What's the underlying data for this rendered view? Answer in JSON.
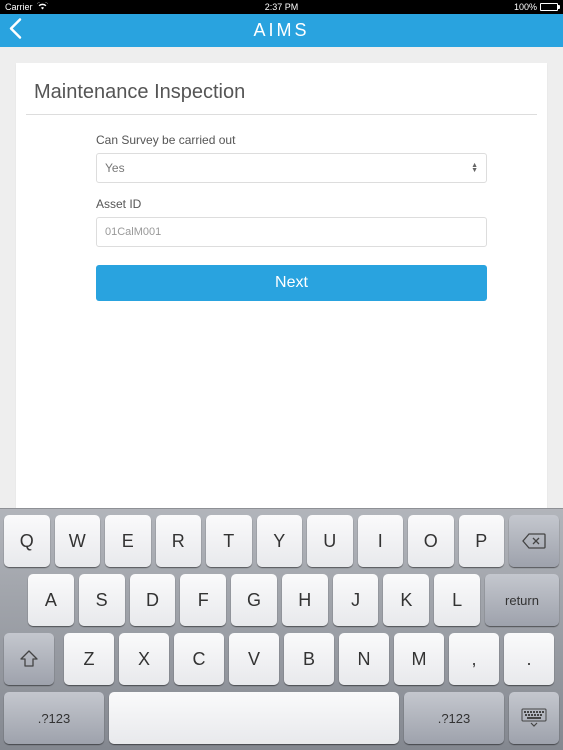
{
  "status": {
    "carrier": "Carrier",
    "time": "2:37 PM",
    "battery": "100%"
  },
  "nav": {
    "title": "AIMS"
  },
  "form": {
    "title": "Maintenance Inspection",
    "survey_label": "Can Survey be carried out",
    "survey_value": "Yes",
    "asset_label": "Asset ID",
    "asset_value": "01CalM001",
    "next_label": "Next"
  },
  "keyboard": {
    "row1": [
      "Q",
      "W",
      "E",
      "R",
      "T",
      "Y",
      "U",
      "I",
      "O",
      "P"
    ],
    "row2": [
      "A",
      "S",
      "D",
      "F",
      "G",
      "H",
      "J",
      "K",
      "L"
    ],
    "row3": [
      "Z",
      "X",
      "C",
      "V",
      "B",
      "N",
      "M",
      ",",
      "."
    ],
    "numeric": ".?123",
    "return": "return"
  }
}
